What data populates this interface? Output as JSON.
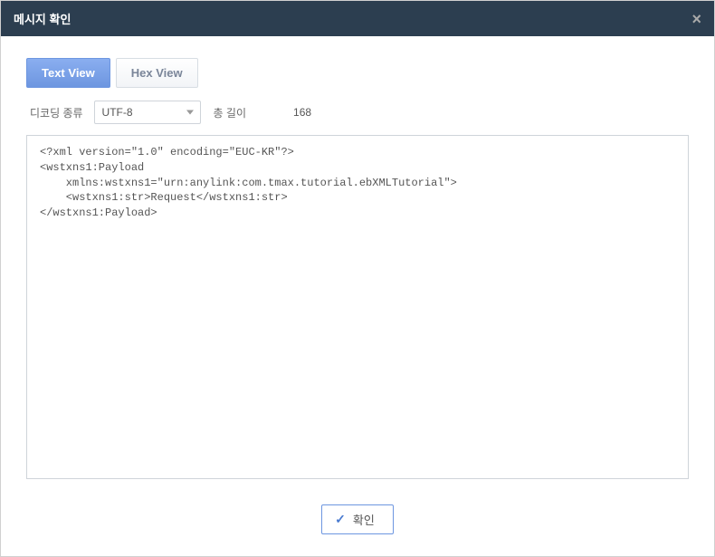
{
  "dialog": {
    "title": "메시지 확인",
    "close_label": "×"
  },
  "tabs": {
    "text_view": "Text View",
    "hex_view": "Hex View"
  },
  "controls": {
    "decoding_label": "디코딩 종류",
    "encoding_value": "UTF-8",
    "length_label": "총 길이",
    "length_value": "168"
  },
  "content": "<?xml version=\"1.0\" encoding=\"EUC-KR\"?>\n<wstxns1:Payload\n    xmlns:wstxns1=\"urn:anylink:com.tmax.tutorial.ebXMLTutorial\">\n    <wstxns1:str>Request</wstxns1:str>\n</wstxns1:Payload>",
  "footer": {
    "confirm_label": "확인"
  }
}
